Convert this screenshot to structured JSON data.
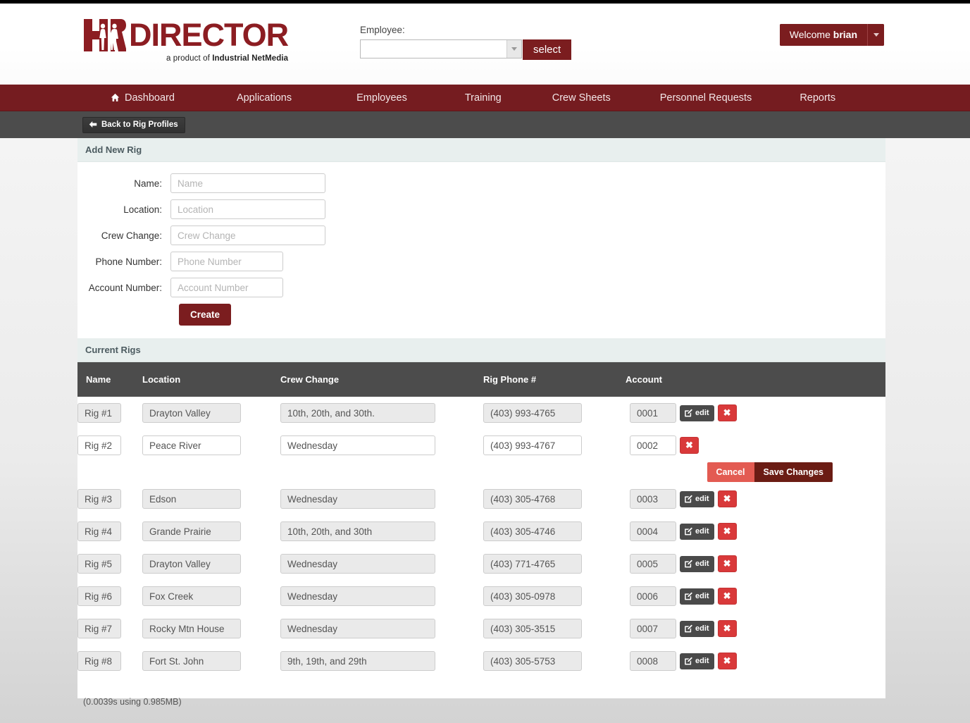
{
  "brand": {
    "logo_mark": "hr-logo-icon",
    "word": "DIRECTOR",
    "tagline_prefix": "a product of ",
    "tagline_company": "Industrial NetMedia",
    "accent_maroon": "#7b1d1f",
    "nav_maroon": "#751c20",
    "subbar_grey": "#4c4c4c",
    "section_head_bg": "#e8efee"
  },
  "header": {
    "employee_label": "Employee:",
    "employee_value": "",
    "employee_placeholder": "",
    "select_button": "select",
    "welcome_prefix": "Welcome ",
    "welcome_user": "brian"
  },
  "nav": {
    "items": [
      {
        "label": "Dashboard",
        "icon": "home-icon",
        "active": true
      },
      {
        "label": "Applications",
        "icon": "",
        "active": false
      },
      {
        "label": "Employees",
        "icon": "",
        "active": false
      },
      {
        "label": "Training",
        "icon": "",
        "active": false
      },
      {
        "label": "Crew Sheets",
        "icon": "",
        "active": false
      },
      {
        "label": "Personnel Requests",
        "icon": "",
        "active": false
      },
      {
        "label": "Reports",
        "icon": "",
        "active": false
      }
    ]
  },
  "subbar": {
    "back_label": "Back to Rig Profiles",
    "back_icon": "arrow-left-icon"
  },
  "add_rig": {
    "title": "Add New Rig",
    "fields": [
      {
        "label": "Name:",
        "placeholder": "Name",
        "value": "",
        "width": "wide"
      },
      {
        "label": "Location:",
        "placeholder": "Location",
        "value": "",
        "width": "wide"
      },
      {
        "label": "Crew Change:",
        "placeholder": "Crew Change",
        "value": "",
        "width": "wide"
      },
      {
        "label": "Phone Number:",
        "placeholder": "Phone Number",
        "value": "",
        "width": "narrow"
      },
      {
        "label": "Account Number:",
        "placeholder": "Account Number",
        "value": "",
        "width": "narrow"
      }
    ],
    "create_button": "Create"
  },
  "current_rigs": {
    "title": "Current Rigs",
    "columns": [
      "Name",
      "Location",
      "Crew Change",
      "Rig Phone #",
      "Account"
    ],
    "edit_label": "edit",
    "edit_icon": "pencil-square-icon",
    "delete_icon": "close-x-icon",
    "delete_label": "✖",
    "cancel_label": "Cancel",
    "save_label": "Save Changes",
    "rows": [
      {
        "name": "Rig #1",
        "location": "Drayton Valley",
        "crew_change": "10th, 20th, and 30th.",
        "phone": "(403) 993-4765",
        "account": "0001",
        "editing": false
      },
      {
        "name": "Rig #2",
        "location": "Peace River",
        "crew_change": "Wednesday",
        "phone": "(403) 993-4767",
        "account": "0002",
        "editing": true
      },
      {
        "name": "Rig #3",
        "location": "Edson",
        "crew_change": "Wednesday",
        "phone": "(403) 305-4768",
        "account": "0003",
        "editing": false
      },
      {
        "name": "Rig #4",
        "location": "Grande Prairie",
        "crew_change": "10th, 20th, and 30th",
        "phone": "(403) 305-4746",
        "account": "0004",
        "editing": false
      },
      {
        "name": "Rig #5",
        "location": "Drayton Valley",
        "crew_change": "Wednesday",
        "phone": "(403) 771-4765",
        "account": "0005",
        "editing": false
      },
      {
        "name": "Rig #6",
        "location": "Fox Creek",
        "crew_change": "Wednesday",
        "phone": "(403) 305-0978",
        "account": "0006",
        "editing": false
      },
      {
        "name": "Rig #7",
        "location": "Rocky Mtn House",
        "crew_change": "Wednesday",
        "phone": "(403) 305-3515",
        "account": "0007",
        "editing": false
      },
      {
        "name": "Rig #8",
        "location": "Fort St. John",
        "crew_change": "9th, 19th, and 29th",
        "phone": "(403) 305-5753",
        "account": "0008",
        "editing": false
      }
    ]
  },
  "footer": {
    "stats": "(0.0039s using 0.985MB)"
  }
}
